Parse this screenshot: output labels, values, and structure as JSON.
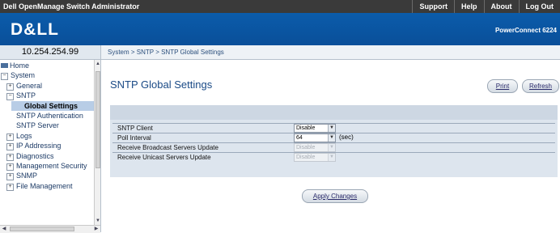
{
  "header": {
    "app_title": "Dell OpenManage Switch Administrator",
    "links": [
      "Support",
      "Help",
      "About",
      "Log Out"
    ]
  },
  "banner": {
    "logo": "D&LL",
    "model": "PowerConnect 6224"
  },
  "ip_address": "10.254.254.99",
  "breadcrumb": "System > SNTP > SNTP Global Settings",
  "tree": [
    {
      "label": "Home",
      "mark": "",
      "indent": 0,
      "selected": false
    },
    {
      "label": "System",
      "mark": "−",
      "indent": 0,
      "selected": false
    },
    {
      "label": "General",
      "mark": "+",
      "indent": 1,
      "selected": false
    },
    {
      "label": "SNTP",
      "mark": "−",
      "indent": 1,
      "selected": false
    },
    {
      "label": "Global Settings",
      "mark": "",
      "indent": 2,
      "selected": true
    },
    {
      "label": "SNTP Authentication",
      "mark": "",
      "indent": 2,
      "selected": false
    },
    {
      "label": "SNTP Server",
      "mark": "",
      "indent": 2,
      "selected": false
    },
    {
      "label": "Logs",
      "mark": "+",
      "indent": 1,
      "selected": false
    },
    {
      "label": "IP Addressing",
      "mark": "+",
      "indent": 1,
      "selected": false
    },
    {
      "label": "Diagnostics",
      "mark": "+",
      "indent": 1,
      "selected": false
    },
    {
      "label": "Management Security",
      "mark": "+",
      "indent": 1,
      "selected": false
    },
    {
      "label": "SNMP",
      "mark": "+",
      "indent": 1,
      "selected": false
    },
    {
      "label": "File Management",
      "mark": "+",
      "indent": 1,
      "selected": false
    }
  ],
  "page": {
    "title": "SNTP Global Settings",
    "print_label": "Print",
    "refresh_label": "Refresh",
    "apply_label": "Apply Changes"
  },
  "settings": [
    {
      "label": "SNTP Client",
      "value": "Disable",
      "unit": "",
      "disabled": false
    },
    {
      "label": "Poll Interval",
      "value": "64",
      "unit": "(sec)",
      "disabled": false
    },
    {
      "label": "Receive Broadcast Servers Update",
      "value": "Disable",
      "unit": "",
      "disabled": true
    },
    {
      "label": "Receive Unicast Servers Update",
      "value": "Disable",
      "unit": "",
      "disabled": true
    }
  ]
}
